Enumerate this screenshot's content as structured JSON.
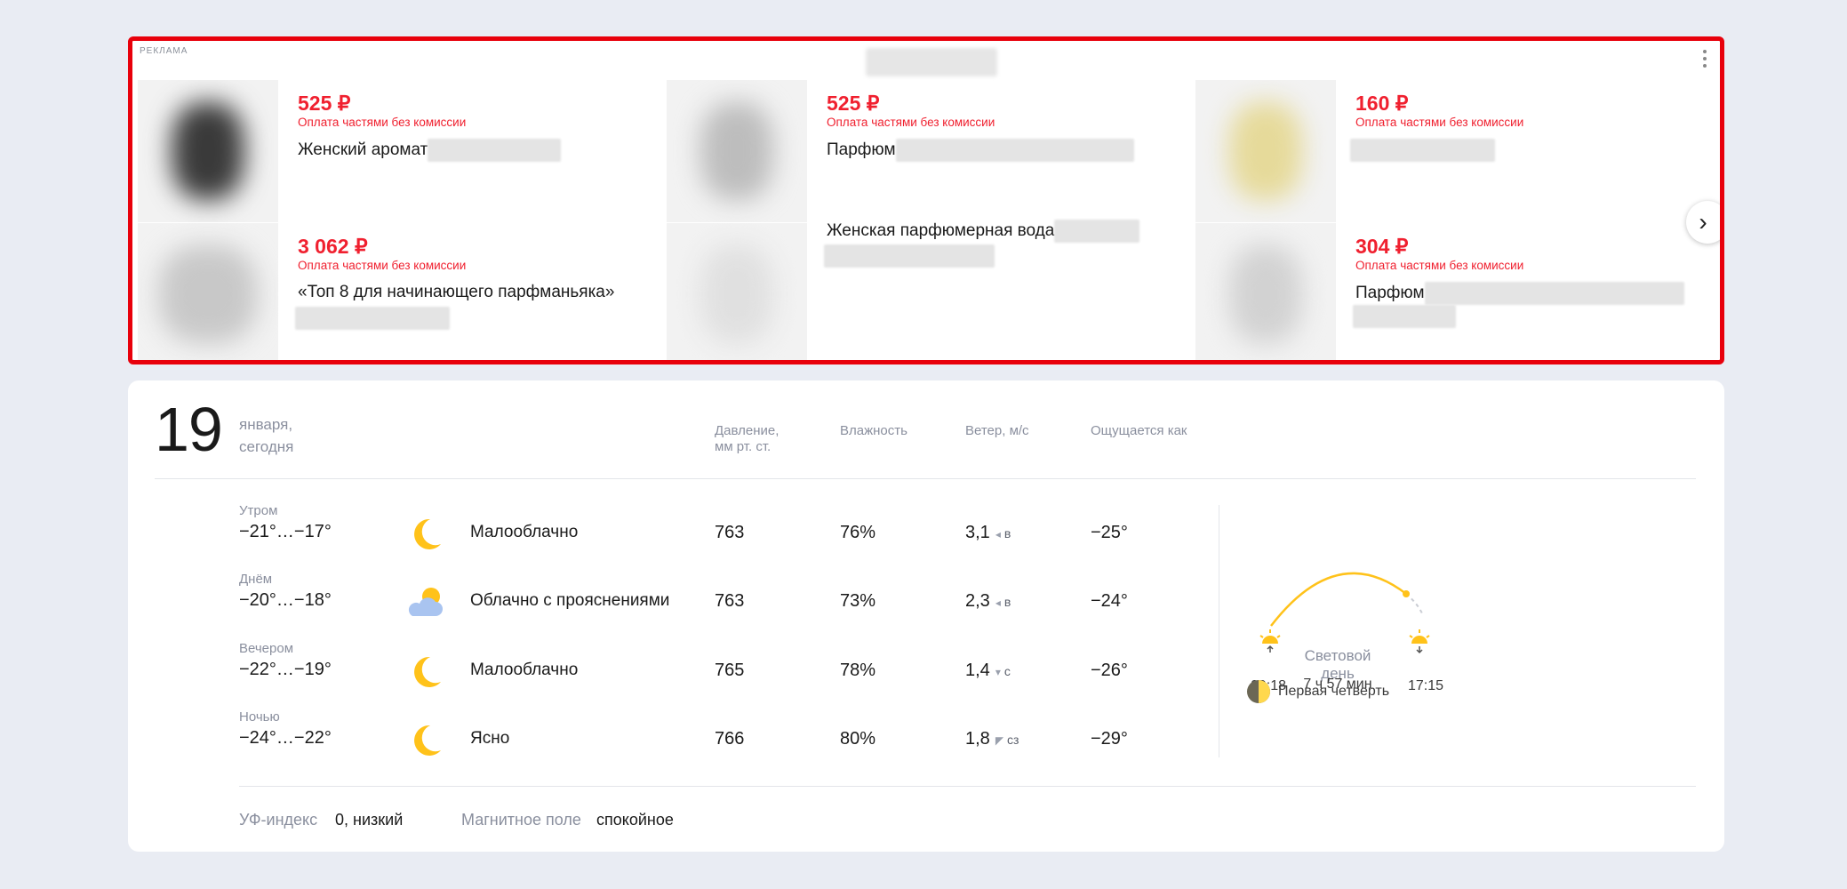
{
  "ad": {
    "label": "РЕКЛАМА",
    "products": [
      {
        "price": "525 ₽",
        "installment": "Оплата частями без комиссии",
        "title": "Женский аромат"
      },
      {
        "price": "525 ₽",
        "installment": "Оплата частями без комиссии",
        "title": "Парфюм"
      },
      {
        "price": "160 ₽",
        "installment": "Оплата частями без комиссии",
        "title": ""
      },
      {
        "price": "3 062 ₽",
        "installment": "Оплата частями без комиссии",
        "title": "«Топ 8 для начинающего парфманьяка»"
      },
      {
        "price": "",
        "installment": "",
        "title": "Женская парфюмерная вода"
      },
      {
        "price": "304 ₽",
        "installment": "Оплата частями без комиссии",
        "title": "Парфюм"
      }
    ],
    "next_icon": "chevron-right-icon",
    "menu_icon": "kebab-menu-icon",
    "border_color": "#e8000b",
    "price_color": "#f0202f"
  },
  "weather": {
    "day_number": "19",
    "day_month": "января,",
    "day_label": "сегодня",
    "columns": {
      "pressure_line1": "Давление,",
      "pressure_line2": "мм рт. ст.",
      "humidity": "Влажность",
      "wind": "Ветер, м/с",
      "feels_like": "Ощущается как"
    },
    "rows": [
      {
        "period": "Утром",
        "temp": "−21°…−17°",
        "icon": "moon-icon",
        "condition": "Малооблачно",
        "pressure": "763",
        "humidity": "76%",
        "wind": "3,1",
        "wind_arrow": "◂",
        "wind_dir": "в",
        "feels": "−25°"
      },
      {
        "period": "Днём",
        "temp": "−20°…−18°",
        "icon": "cloud-sun-icon",
        "condition": "Облачно с прояснениями",
        "pressure": "763",
        "humidity": "73%",
        "wind": "2,3",
        "wind_arrow": "◂",
        "wind_dir": "в",
        "feels": "−24°"
      },
      {
        "period": "Вечером",
        "temp": "−22°…−19°",
        "icon": "moon-icon",
        "condition": "Малооблачно",
        "pressure": "765",
        "humidity": "78%",
        "wind": "1,4",
        "wind_arrow": "▾",
        "wind_dir": "с",
        "feels": "−26°"
      },
      {
        "period": "Ночью",
        "temp": "−24°…−22°",
        "icon": "moon-icon",
        "condition": "Ясно",
        "pressure": "766",
        "humidity": "80%",
        "wind": "1,8",
        "wind_arrow": "◤",
        "wind_dir": "сз",
        "feels": "−29°"
      }
    ],
    "sun": {
      "sunrise": "09:18",
      "sunset": "17:15",
      "daylight_line1": "Световой",
      "daylight_line2": "день",
      "daylight_length": "7 ч 57 мин"
    },
    "moon_phase": "Первая четверть",
    "uv_label": "УФ-индекс",
    "uv_value": "0, низкий",
    "magnetic_label": "Магнитное поле",
    "magnetic_value": "спокойное",
    "accent_color": "#ffc21a"
  }
}
